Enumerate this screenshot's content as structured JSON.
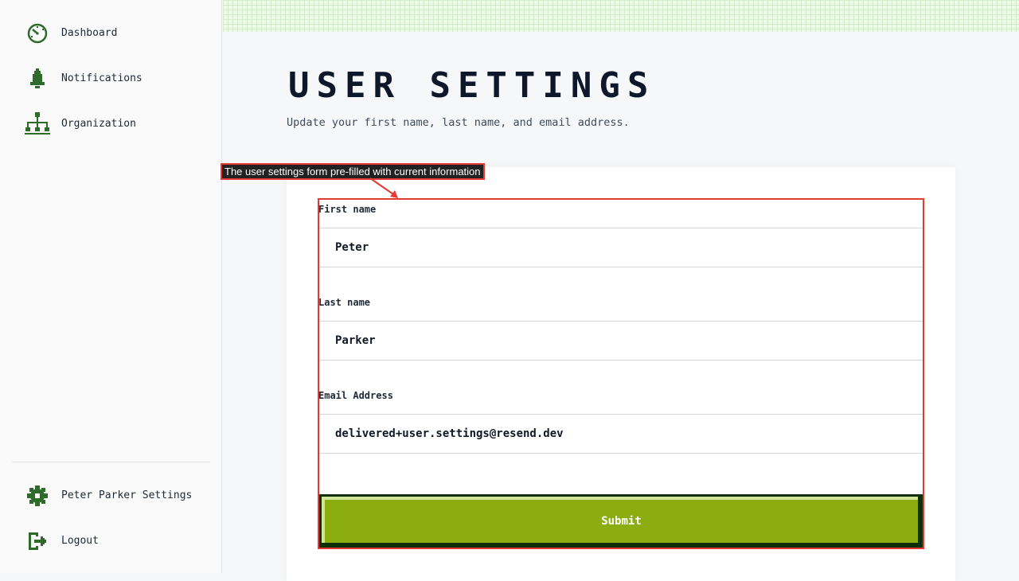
{
  "sidebar": {
    "nav": [
      {
        "label": "Dashboard",
        "icon": "dashboard-icon"
      },
      {
        "label": "Notifications",
        "icon": "bell-icon"
      },
      {
        "label": "Organization",
        "icon": "org-chart-icon"
      }
    ],
    "footer": [
      {
        "label": "Peter Parker Settings",
        "icon": "gear-icon"
      },
      {
        "label": "Logout",
        "icon": "logout-icon"
      }
    ]
  },
  "page": {
    "title": "USER SETTINGS",
    "subtitle": "Update your first name, last name, and email address."
  },
  "form": {
    "first_name": {
      "label": "First name",
      "value": "Peter"
    },
    "last_name": {
      "label": "Last name",
      "value": "Parker"
    },
    "email": {
      "label": "Email Address",
      "value": "delivered+user.settings@resend.dev"
    },
    "submit_label": "Submit"
  },
  "annotation": {
    "text": "The user settings form pre-filled with current information"
  },
  "colors": {
    "accent_green": "#8cad10",
    "icon_green": "#2e6b2b",
    "highlight_red": "#e53935"
  }
}
